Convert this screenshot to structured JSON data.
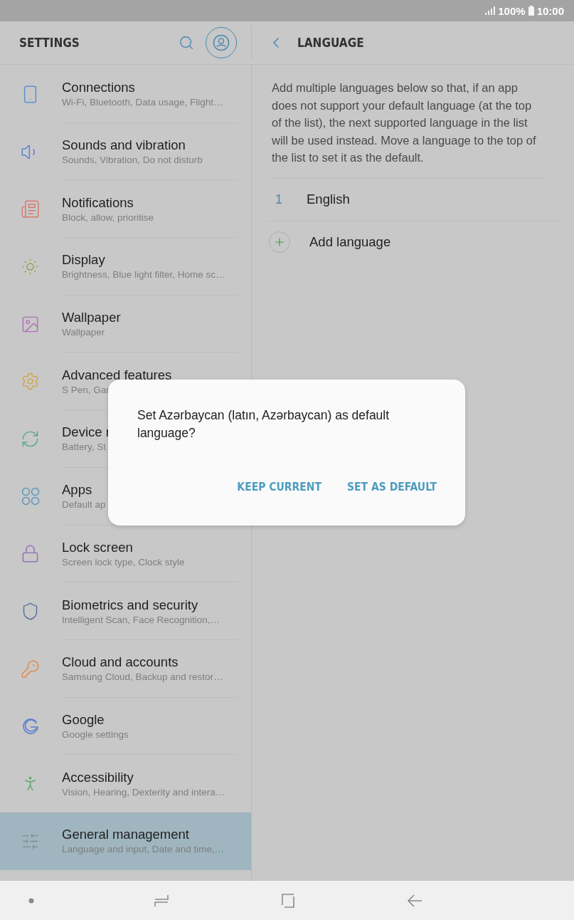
{
  "status_bar": {
    "battery": "100%",
    "time": "10:00"
  },
  "sidebar": {
    "title": "SETTINGS",
    "items": [
      {
        "title": "Connections",
        "subtitle": "Wi-Fi, Bluetooth, Data usage, Flight…",
        "selected": false
      },
      {
        "title": "Sounds and vibration",
        "subtitle": "Sounds, Vibration, Do not disturb",
        "selected": false
      },
      {
        "title": "Notifications",
        "subtitle": "Block, allow, prioritise",
        "selected": false
      },
      {
        "title": "Display",
        "subtitle": "Brightness, Blue light filter, Home sc…",
        "selected": false
      },
      {
        "title": "Wallpaper",
        "subtitle": "Wallpaper",
        "selected": false
      },
      {
        "title": "Advanced features",
        "subtitle": "S Pen, Gar",
        "selected": false
      },
      {
        "title": "Device r",
        "subtitle": "Battery, St",
        "selected": false
      },
      {
        "title": "Apps",
        "subtitle": "Default ap",
        "selected": false
      },
      {
        "title": "Lock screen",
        "subtitle": "Screen lock type, Clock style",
        "selected": false
      },
      {
        "title": "Biometrics and security",
        "subtitle": "Intelligent Scan, Face Recognition,…",
        "selected": false
      },
      {
        "title": "Cloud and accounts",
        "subtitle": "Samsung Cloud, Backup and restor…",
        "selected": false
      },
      {
        "title": "Google",
        "subtitle": "Google settings",
        "selected": false
      },
      {
        "title": "Accessibility",
        "subtitle": "Vision, Hearing, Dexterity and intera…",
        "selected": false
      },
      {
        "title": "General management",
        "subtitle": "Language and input, Date and time,…",
        "selected": true
      }
    ]
  },
  "detail": {
    "title": "LANGUAGE",
    "description": "Add multiple languages below so that, if an app does not support your default language (at the top of the list), the next supported language in the list will be used instead. Move a language to the top of the list to set it as the default.",
    "languages": [
      {
        "number": "1",
        "name": "English"
      }
    ],
    "add_label": "Add language"
  },
  "dialog": {
    "message": "Set Azərbaycan (latın, Azərbaycan) as default language?",
    "buttons": [
      "KEEP CURRENT",
      "SET AS DEFAULT"
    ]
  }
}
